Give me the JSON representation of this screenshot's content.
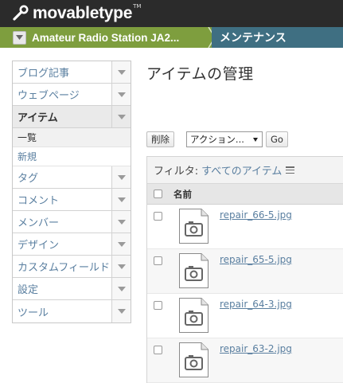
{
  "brand": {
    "name_part1": "movable",
    "name_part2": "type",
    "tm": "TM"
  },
  "breadcrumb": {
    "site": "Amateur Radio Station JA2...",
    "page": "メンテナンス"
  },
  "sidebar": {
    "items": [
      {
        "label": "ブログ記事"
      },
      {
        "label": "ウェブページ"
      },
      {
        "label": "アイテム"
      },
      {
        "label": "タグ"
      },
      {
        "label": "コメント"
      },
      {
        "label": "メンバー"
      },
      {
        "label": "デザイン"
      },
      {
        "label": "カスタムフィールド"
      },
      {
        "label": "設定"
      },
      {
        "label": "ツール"
      }
    ],
    "subitems": [
      {
        "label": "一覧"
      },
      {
        "label": "新規"
      }
    ]
  },
  "main": {
    "title": "アイテムの管理",
    "toolbar": {
      "delete_label": "削除",
      "action_value": "アクション...",
      "go_label": "Go"
    },
    "filter": {
      "label": "フィルタ:",
      "value": "すべてのアイテム"
    },
    "table": {
      "name_header": "名前",
      "rows": [
        {
          "name": "repair_66-5.jpg"
        },
        {
          "name": "repair_65-5.jpg"
        },
        {
          "name": "repair_64-3.jpg"
        },
        {
          "name": "repair_63-2.jpg"
        }
      ]
    }
  },
  "colors": {
    "header_bg": "#2b2b2b",
    "breadcrumb_green": "#7e9e3e",
    "breadcrumb_blue": "#3f6f82",
    "link": "#5a7fa0"
  }
}
